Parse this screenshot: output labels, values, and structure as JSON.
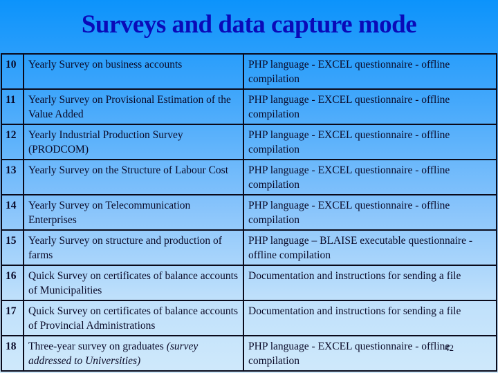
{
  "slide": {
    "title": "Surveys and data capture mode",
    "page_number": "42"
  },
  "table": {
    "rows": [
      {
        "num": "10",
        "survey": "Yearly Survey on business accounts",
        "survey_note": "",
        "mode": "PHP language - EXCEL questionnaire - offline compilation"
      },
      {
        "num": "11",
        "survey": "Yearly Survey on Provisional Estimation of the Value Added",
        "survey_note": "",
        "mode": "PHP language - EXCEL questionnaire - offline compilation"
      },
      {
        "num": "12",
        "survey": "Yearly Industrial Production Survey (PRODCOM)",
        "survey_note": "",
        "mode": "PHP language - EXCEL questionnaire - offline compilation"
      },
      {
        "num": "13",
        "survey": "Yearly Survey on the Structure of  Labour Cost",
        "survey_note": "",
        "mode": "PHP language - EXCEL questionnaire - offline compilation"
      },
      {
        "num": "14",
        "survey": "Yearly Survey on Telecommunication Enterprises",
        "survey_note": "",
        "mode": "PHP language - EXCEL questionnaire - offline compilation"
      },
      {
        "num": "15",
        "survey": "Yearly Survey on structure and production of farms",
        "survey_note": "",
        "mode": "PHP language – BLAISE executable questionnaire - offline compilation"
      },
      {
        "num": "16",
        "survey": "Quick Survey on certificates of balance accounts of Municipalities",
        "survey_note": "",
        "mode": "Documentation and instructions for sending a file"
      },
      {
        "num": "17",
        "survey": "Quick Survey on certificates of balance accounts of  Provincial Administrations",
        "survey_note": "",
        "mode": "Documentation and instructions for sending a file"
      },
      {
        "num": "18",
        "survey": "Three-year survey on graduates ",
        "survey_note": "(survey addressed to Universities)",
        "mode": "PHP language - EXCEL questionnaire - offline compilation"
      }
    ]
  }
}
